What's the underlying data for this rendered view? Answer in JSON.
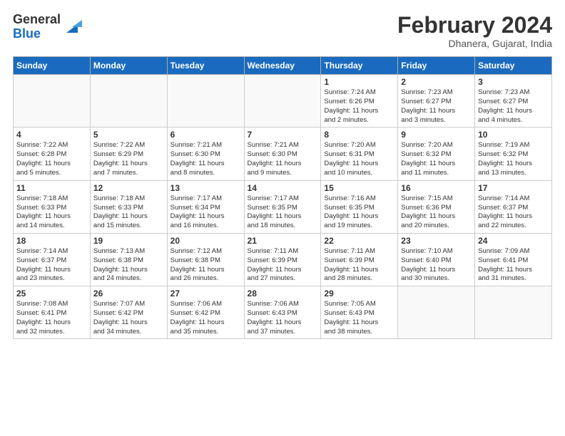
{
  "logo": {
    "general": "General",
    "blue": "Blue"
  },
  "title": "February 2024",
  "location": "Dhanera, Gujarat, India",
  "days_header": [
    "Sunday",
    "Monday",
    "Tuesday",
    "Wednesday",
    "Thursday",
    "Friday",
    "Saturday"
  ],
  "weeks": [
    [
      {
        "day": "",
        "detail": ""
      },
      {
        "day": "",
        "detail": ""
      },
      {
        "day": "",
        "detail": ""
      },
      {
        "day": "",
        "detail": ""
      },
      {
        "day": "1",
        "detail": "Sunrise: 7:24 AM\nSunset: 6:26 PM\nDaylight: 11 hours\nand 2 minutes."
      },
      {
        "day": "2",
        "detail": "Sunrise: 7:23 AM\nSunset: 6:27 PM\nDaylight: 11 hours\nand 3 minutes."
      },
      {
        "day": "3",
        "detail": "Sunrise: 7:23 AM\nSunset: 6:27 PM\nDaylight: 11 hours\nand 4 minutes."
      }
    ],
    [
      {
        "day": "4",
        "detail": "Sunrise: 7:22 AM\nSunset: 6:28 PM\nDaylight: 11 hours\nand 5 minutes."
      },
      {
        "day": "5",
        "detail": "Sunrise: 7:22 AM\nSunset: 6:29 PM\nDaylight: 11 hours\nand 7 minutes."
      },
      {
        "day": "6",
        "detail": "Sunrise: 7:21 AM\nSunset: 6:30 PM\nDaylight: 11 hours\nand 8 minutes."
      },
      {
        "day": "7",
        "detail": "Sunrise: 7:21 AM\nSunset: 6:30 PM\nDaylight: 11 hours\nand 9 minutes."
      },
      {
        "day": "8",
        "detail": "Sunrise: 7:20 AM\nSunset: 6:31 PM\nDaylight: 11 hours\nand 10 minutes."
      },
      {
        "day": "9",
        "detail": "Sunrise: 7:20 AM\nSunset: 6:32 PM\nDaylight: 11 hours\nand 11 minutes."
      },
      {
        "day": "10",
        "detail": "Sunrise: 7:19 AM\nSunset: 6:32 PM\nDaylight: 11 hours\nand 13 minutes."
      }
    ],
    [
      {
        "day": "11",
        "detail": "Sunrise: 7:18 AM\nSunset: 6:33 PM\nDaylight: 11 hours\nand 14 minutes."
      },
      {
        "day": "12",
        "detail": "Sunrise: 7:18 AM\nSunset: 6:33 PM\nDaylight: 11 hours\nand 15 minutes."
      },
      {
        "day": "13",
        "detail": "Sunrise: 7:17 AM\nSunset: 6:34 PM\nDaylight: 11 hours\nand 16 minutes."
      },
      {
        "day": "14",
        "detail": "Sunrise: 7:17 AM\nSunset: 6:35 PM\nDaylight: 11 hours\nand 18 minutes."
      },
      {
        "day": "15",
        "detail": "Sunrise: 7:16 AM\nSunset: 6:35 PM\nDaylight: 11 hours\nand 19 minutes."
      },
      {
        "day": "16",
        "detail": "Sunrise: 7:15 AM\nSunset: 6:36 PM\nDaylight: 11 hours\nand 20 minutes."
      },
      {
        "day": "17",
        "detail": "Sunrise: 7:14 AM\nSunset: 6:37 PM\nDaylight: 11 hours\nand 22 minutes."
      }
    ],
    [
      {
        "day": "18",
        "detail": "Sunrise: 7:14 AM\nSunset: 6:37 PM\nDaylight: 11 hours\nand 23 minutes."
      },
      {
        "day": "19",
        "detail": "Sunrise: 7:13 AM\nSunset: 6:38 PM\nDaylight: 11 hours\nand 24 minutes."
      },
      {
        "day": "20",
        "detail": "Sunrise: 7:12 AM\nSunset: 6:38 PM\nDaylight: 11 hours\nand 26 minutes."
      },
      {
        "day": "21",
        "detail": "Sunrise: 7:11 AM\nSunset: 6:39 PM\nDaylight: 11 hours\nand 27 minutes."
      },
      {
        "day": "22",
        "detail": "Sunrise: 7:11 AM\nSunset: 6:39 PM\nDaylight: 11 hours\nand 28 minutes."
      },
      {
        "day": "23",
        "detail": "Sunrise: 7:10 AM\nSunset: 6:40 PM\nDaylight: 11 hours\nand 30 minutes."
      },
      {
        "day": "24",
        "detail": "Sunrise: 7:09 AM\nSunset: 6:41 PM\nDaylight: 11 hours\nand 31 minutes."
      }
    ],
    [
      {
        "day": "25",
        "detail": "Sunrise: 7:08 AM\nSunset: 6:41 PM\nDaylight: 11 hours\nand 32 minutes."
      },
      {
        "day": "26",
        "detail": "Sunrise: 7:07 AM\nSunset: 6:42 PM\nDaylight: 11 hours\nand 34 minutes."
      },
      {
        "day": "27",
        "detail": "Sunrise: 7:06 AM\nSunset: 6:42 PM\nDaylight: 11 hours\nand 35 minutes."
      },
      {
        "day": "28",
        "detail": "Sunrise: 7:06 AM\nSunset: 6:43 PM\nDaylight: 11 hours\nand 37 minutes."
      },
      {
        "day": "29",
        "detail": "Sunrise: 7:05 AM\nSunset: 6:43 PM\nDaylight: 11 hours\nand 38 minutes."
      },
      {
        "day": "",
        "detail": ""
      },
      {
        "day": "",
        "detail": ""
      }
    ]
  ]
}
